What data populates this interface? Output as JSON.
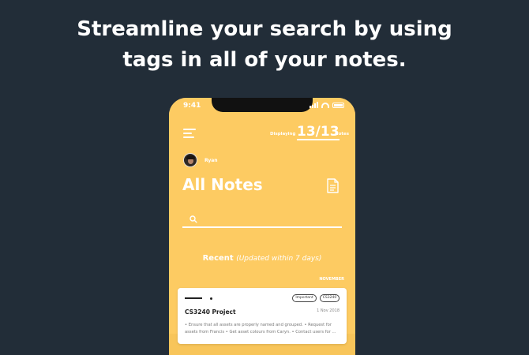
{
  "headline": {
    "line1": "Streamline your search by using",
    "line2": "tags in all of your notes."
  },
  "status_bar": {
    "time": "9:41",
    "icons": [
      "signal-icon",
      "wifi-icon",
      "battery-icon"
    ]
  },
  "header": {
    "menu_icon": "hamburger-menu-icon",
    "displaying_label": "Displaying",
    "count": "13/13",
    "notes_label": "Notes"
  },
  "user": {
    "name": "Ryan"
  },
  "page": {
    "title": "All Notes",
    "action_icon": "document-icon"
  },
  "search": {
    "icon": "search-icon",
    "placeholder": ""
  },
  "recent": {
    "title": "Recent",
    "subtitle": "(Updated within 7 days)",
    "month": "NOVEMBER"
  },
  "notes": [
    {
      "tags": [
        "Important",
        "CS3240"
      ],
      "title": "CS3240 Project",
      "date": "1 Nov 2018",
      "body": "• Ensure that all assets are properly named and grouped. • Request for assets from Francis • Get asset colours from Caryn. • Contact users for ..."
    }
  ],
  "colors": {
    "background": "#222d38",
    "accent": "#fdcb62",
    "text_light": "#ffffff",
    "card": "#ffffff"
  }
}
